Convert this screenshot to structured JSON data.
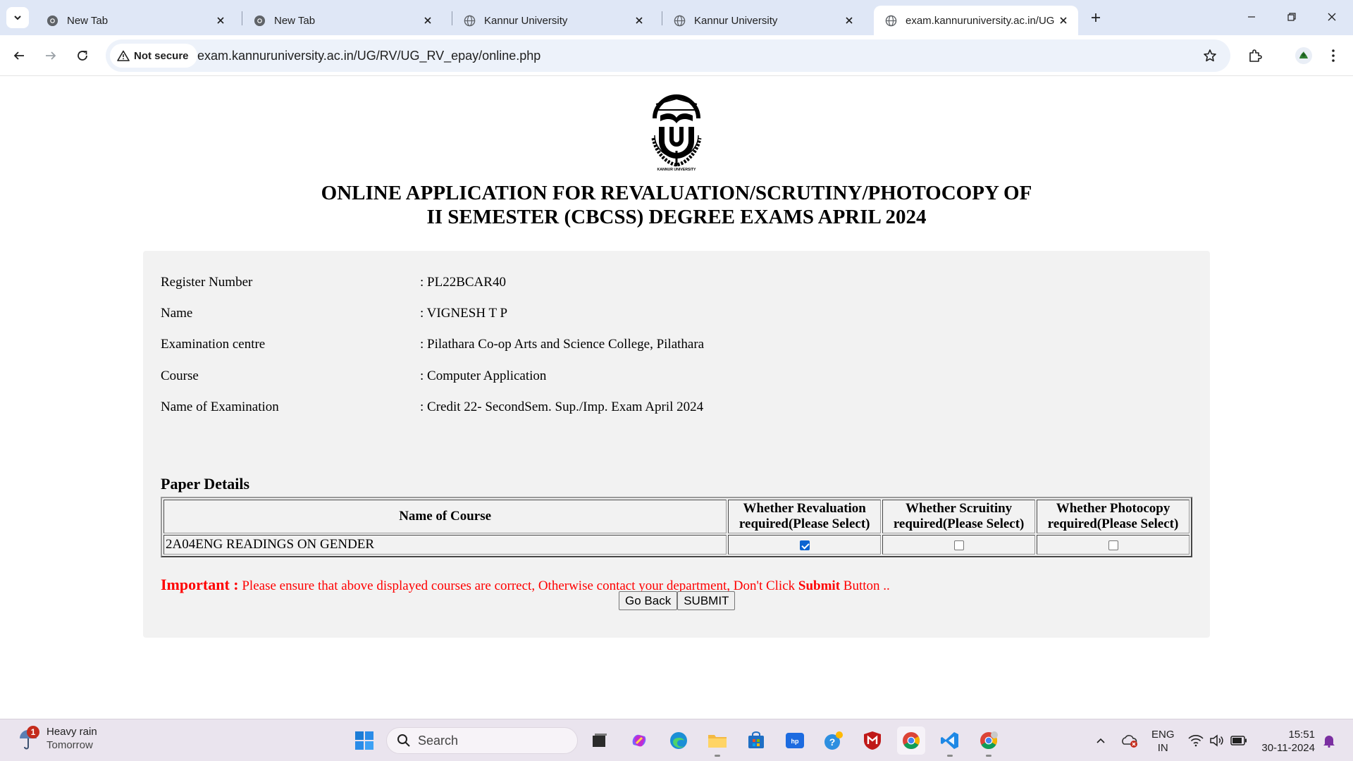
{
  "browser": {
    "tabs": [
      {
        "title": "New Tab",
        "icon": "chrome-icon",
        "active": false
      },
      {
        "title": "New Tab",
        "icon": "chrome-icon",
        "active": false
      },
      {
        "title": "Kannur University",
        "icon": "globe-icon",
        "active": false
      },
      {
        "title": "Kannur University",
        "icon": "globe-icon",
        "active": false
      },
      {
        "title": "exam.kannuruniversity.ac.in/UG",
        "icon": "globe-icon",
        "active": true
      }
    ],
    "security_label": "Not secure",
    "url": "exam.kannuruniversity.ac.in/UG/RV/UG_RV_epay/online.php"
  },
  "page": {
    "title_line1": "ONLINE APPLICATION FOR REVALUATION/SCRUTINY/PHOTOCOPY OF",
    "title_line2": "II SEMESTER (CBCSS) DEGREE EXAMS APRIL 2024",
    "logo_text": "KANNUR UNIVERSITY",
    "details": [
      {
        "label": "Register Number",
        "value": ": PL22BCAR40"
      },
      {
        "label": "Name",
        "value": ": VIGNESH T P"
      },
      {
        "label": "Examination centre",
        "value": ": Pilathara Co-op Arts and Science College, Pilathara"
      },
      {
        "label": "Course",
        "value": ": Computer Application"
      },
      {
        "label": "Name of Examination",
        "value": ": Credit 22- SecondSem. Sup./Imp. Exam April 2024"
      }
    ],
    "paper_heading": "Paper Details",
    "table": {
      "headers": {
        "course": "Name of Course",
        "revaluation_l1": "Whether Revaluation",
        "revaluation_l2": "required(Please Select)",
        "scrutiny_l1": "Whether Scruitiny",
        "scrutiny_l2": "required(Please Select)",
        "photocopy_l1": "Whether Photocopy",
        "photocopy_l2": "required(Please Select)"
      },
      "rows": [
        {
          "course": "2A04ENG READINGS ON GENDER",
          "revaluation": true,
          "scrutiny": false,
          "photocopy": false
        }
      ]
    },
    "important": {
      "label": "Important :",
      "text": " Please ensure that above displayed courses are correct, Otherwise contact your department, Don't Click ",
      "bold": "Submit",
      "suffix": " Button .."
    },
    "buttons": {
      "back": "Go Back",
      "submit": "SUBMIT"
    }
  },
  "taskbar": {
    "weather_badge": "1",
    "weather_title": "Heavy rain",
    "weather_sub": "Tomorrow",
    "search_placeholder": "Search",
    "lang_line1": "ENG",
    "lang_line2": "IN",
    "time": "15:51",
    "date": "30-11-2024"
  },
  "colors": {
    "tabstrip": "#dfe7f6",
    "omnibox": "#edf2fa",
    "form_bg": "#f2f2f2",
    "important_red": "#ff0000",
    "checkbox_blue": "#0b63d1",
    "taskbar": "#eae4ee"
  }
}
